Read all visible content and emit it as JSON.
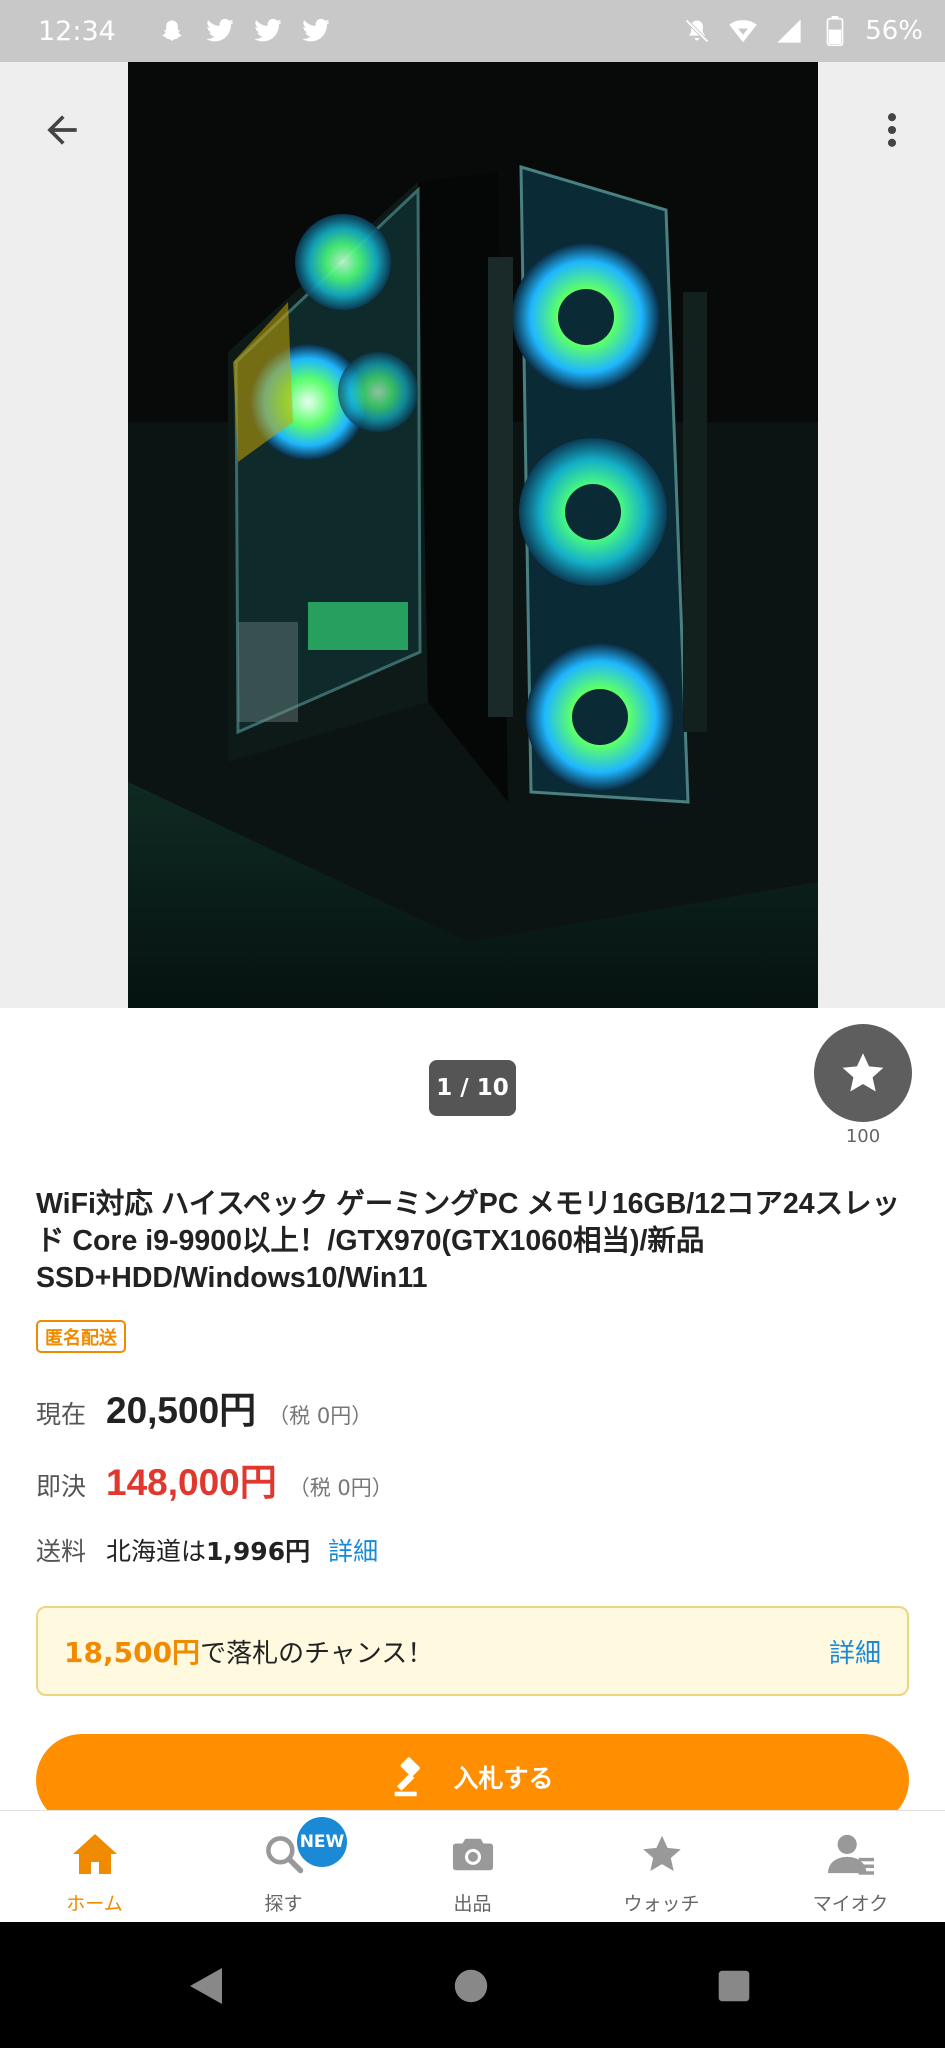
{
  "status_bar": {
    "time": "12:34",
    "battery": "56%",
    "icons": [
      "snapchat-icon",
      "twitter-icon",
      "twitter-icon",
      "twitter-icon",
      "mute-notification-icon",
      "wifi-icon",
      "signal-icon",
      "battery-icon"
    ]
  },
  "photo": {
    "counter": "1 / 10",
    "watch_count": "100",
    "description_icons": [
      "back-arrow-icon",
      "more-vert-icon",
      "star-icon"
    ]
  },
  "item": {
    "title": "WiFi対応 ハイスペック ゲーミングPC メモリ16GB/12コア24スレッド Core i9-9900以上！/GTX970(GTX1060相当)/新品SSD+HDD/Windows10/Win11",
    "badge": "匿名配送"
  },
  "prices": {
    "current_label": "現在",
    "current_price": "20,500円",
    "current_tax": "（税 0円）",
    "buyout_label": "即決",
    "buyout_price": "148,000円",
    "buyout_tax": "（税 0円）",
    "shipping_label": "送料",
    "shipping_prefix": "北海道は",
    "shipping_amount": "1,996円",
    "shipping_link": "詳細"
  },
  "chance": {
    "amount": "18,500円",
    "text": "で落札のチャンス！",
    "link": "詳細"
  },
  "bid_button": {
    "label": "入札する"
  },
  "bottom_nav": {
    "items": [
      {
        "label": "ホーム",
        "icon": "home-icon",
        "active": true
      },
      {
        "label": "探す",
        "icon": "search-icon",
        "badge": "NEW"
      },
      {
        "label": "出品",
        "icon": "camera-icon"
      },
      {
        "label": "ウォッチ",
        "icon": "star-icon"
      },
      {
        "label": "マイオク",
        "icon": "person-icon"
      }
    ]
  },
  "colors": {
    "accent_orange": "#ff8f00",
    "badge_orange": "#f08b00",
    "buyout_red": "#e0372e",
    "link_blue": "#1a8ad6",
    "chance_bg": "#fff9e0"
  }
}
